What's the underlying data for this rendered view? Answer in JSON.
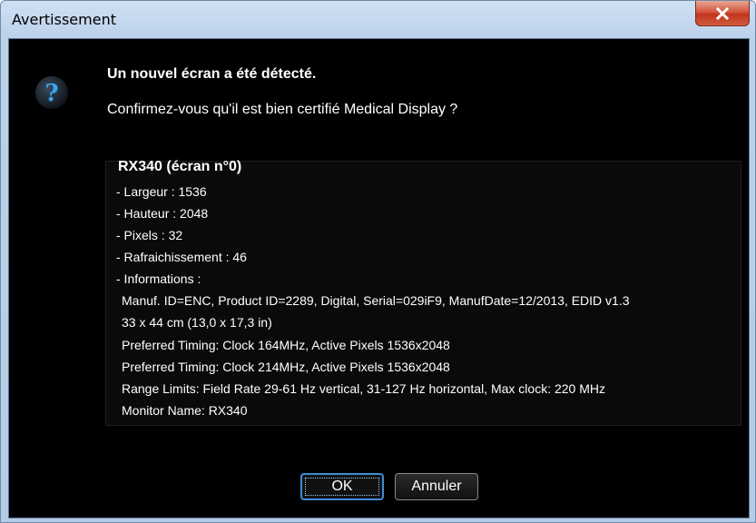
{
  "window": {
    "title": "Avertissement",
    "close_icon": "close-icon",
    "colors": {
      "background": "#000000",
      "text": "#ffffff",
      "accent": "#3c8cd8",
      "close": "#c2351c"
    }
  },
  "message": {
    "icon": "question-icon",
    "title": "Un nouvel écran a été détecté.",
    "question": "Confirmez-vous qu'il est bien certifié Medical Display ?"
  },
  "display_info": {
    "heading": "RX340 (écran n°0)",
    "lines": [
      "- Largeur : 1536",
      "- Hauteur : 2048",
      "- Pixels : 32",
      "- Rafraichissement : 46",
      "- Informations :"
    ],
    "details": [
      "Manuf. ID=ENC, Product ID=2289, Digital, Serial=029iF9, ManufDate=12/2013, EDID v1.3",
      "33 x 44 cm (13,0 x 17,3 in)",
      "Preferred Timing: Clock 164MHz, Active Pixels 1536x2048",
      "Preferred Timing: Clock 214MHz, Active Pixels 1536x2048",
      "Range Limits: Field Rate 29-61 Hz vertical, 31-127 Hz horizontal, Max clock: 220 MHz",
      "Monitor Name: RX340"
    ]
  },
  "buttons": {
    "ok": "OK",
    "cancel": "Annuler"
  }
}
